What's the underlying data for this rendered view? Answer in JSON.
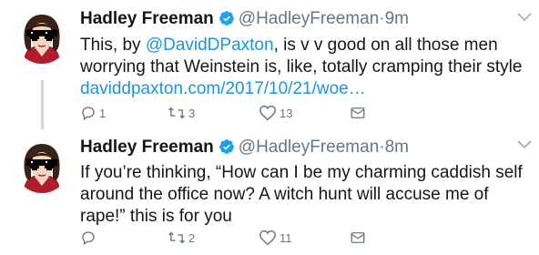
{
  "tweets": [
    {
      "author_name": "Hadley Freeman",
      "author_handle": "@HadleyFreeman",
      "separator": "·",
      "time": "9m",
      "text_1": "This, by ",
      "mention": "@DavidDPaxton",
      "text_2": ", is v v good on all those men worrying that Weinstein is, like, totally cramping their style",
      "link": "daviddpaxton.com/2017/10/21/woe…",
      "reply_count": "1",
      "retweet_count": "3",
      "like_count": "13"
    },
    {
      "author_name": "Hadley Freeman",
      "author_handle": "@HadleyFreeman",
      "separator": "·",
      "time": "8m",
      "text": "If you’re thinking, “How can I be my charming caddish self around the office now? A witch hunt will accuse me of rape!” this is for you",
      "reply_count": "",
      "retweet_count": "2",
      "like_count": "11"
    }
  ],
  "colors": {
    "link": "#1b95e0",
    "secondary_text": "#657786",
    "verified_badge": "#1da1f2",
    "thread_line": "#ccd6dd"
  },
  "icons": [
    "verified-badge-icon",
    "chevron-down-icon",
    "reply-icon",
    "retweet-icon",
    "like-icon",
    "direct-message-icon"
  ]
}
